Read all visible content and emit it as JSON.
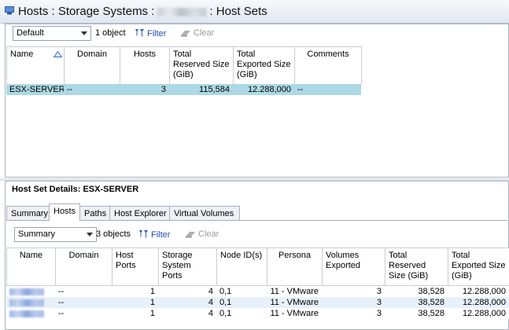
{
  "window": {
    "title_prefix": "Hosts : Storage Systems :",
    "title_suffix": ": Host Sets"
  },
  "top_toolbar": {
    "view_select": "Default",
    "count": "1 object",
    "filter_label": "Filter",
    "clear_label": "Clear"
  },
  "host_sets_table": {
    "columns": [
      "Name",
      "Domain",
      "Hosts",
      "Total Reserved Size (GiB)",
      "Total Exported Size (GiB)",
      "Comments"
    ],
    "rows": [
      {
        "name": "ESX-SERVER",
        "domain": "--",
        "hosts": "3",
        "reserved": "115,584",
        "exported": "12.288,000",
        "comments": "--"
      }
    ]
  },
  "details": {
    "title": "Host Set Details: ESX-SERVER",
    "tabs": [
      "Summary",
      "Hosts",
      "Paths",
      "Host Explorer",
      "Virtual Volumes"
    ],
    "active_tab": "Hosts"
  },
  "bottom_toolbar": {
    "view_select": "Summary",
    "count": "3 objects",
    "filter_label": "Filter",
    "clear_label": "Clear"
  },
  "hosts_table": {
    "columns": [
      "Name",
      "Domain",
      "Host Ports",
      "Storage System Ports",
      "Node ID(s)",
      "Persona",
      "Volumes Exported",
      "Total Reserved Size (GiB)",
      "Total Exported Size (GiB)"
    ],
    "rows": [
      {
        "domain": "--",
        "host_ports": "1",
        "system_ports": "4",
        "node_ids": "0,1",
        "persona": "11 - VMware",
        "volumes": "3",
        "reserved": "38,528",
        "exported": "12.288,000"
      },
      {
        "domain": "--",
        "host_ports": "1",
        "system_ports": "4",
        "node_ids": "0,1",
        "persona": "11 - VMware",
        "volumes": "3",
        "reserved": "38,528",
        "exported": "12.288,000"
      },
      {
        "domain": "--",
        "host_ports": "1",
        "system_ports": "4",
        "node_ids": "0,1",
        "persona": "11 - VMware",
        "volumes": "3",
        "reserved": "38,528",
        "exported": "12.288,000"
      }
    ]
  },
  "colors": {
    "selected_row": "#add8e6",
    "alt_row": "#e8f1fb",
    "link": "#1f4fa8"
  }
}
